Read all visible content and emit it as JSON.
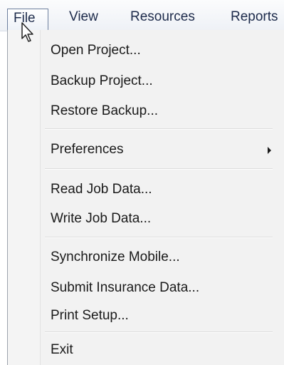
{
  "menubar": {
    "items": [
      {
        "label": "File"
      },
      {
        "label": "View"
      },
      {
        "label": "Resources"
      },
      {
        "label": "Reports"
      }
    ]
  },
  "file_menu": {
    "items": [
      {
        "label": "Open Project..."
      },
      {
        "label": "Backup Project..."
      },
      {
        "label": "Restore Backup..."
      },
      {
        "label": "Preferences"
      },
      {
        "label": "Read Job Data..."
      },
      {
        "label": "Write Job Data..."
      },
      {
        "label": "Synchronize Mobile..."
      },
      {
        "label": "Submit Insurance Data..."
      },
      {
        "label": "Print Setup..."
      },
      {
        "label": "Exit"
      }
    ]
  }
}
